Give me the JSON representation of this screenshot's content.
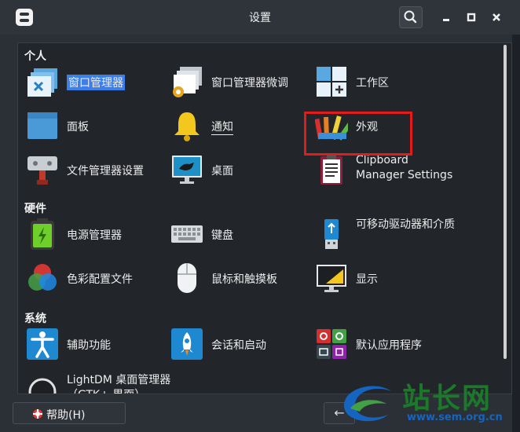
{
  "window": {
    "title": "设置"
  },
  "sections": {
    "personal": "个人",
    "hardware": "硬件",
    "system": "系统"
  },
  "items": {
    "window_manager": "窗口管理器",
    "wm_tweaks": "窗口管理器微调",
    "workspaces": "工作区",
    "panel": "面板",
    "notifications": "通知",
    "appearance": "外观",
    "file_manager": "文件管理器设置",
    "desktop": "桌面",
    "clipboard": "Clipboard Manager Settings",
    "power_manager": "电源管理器",
    "keyboard": "键盘",
    "removable": "可移动驱动器和介质",
    "color_profiles": "色彩配置文件",
    "mouse": "鼠标和触摸板",
    "display": "显示",
    "accessibility": "辅助功能",
    "session": "会话和启动",
    "default_apps": "默认应用程序",
    "lightdm": "LightDM 桌面管理器（GTK+ 界面）"
  },
  "footer": {
    "help_label": "帮助(H)",
    "back_label": "←"
  },
  "watermark": {
    "name": "站长网",
    "url": "www.sem.org.cn"
  },
  "colors": {
    "selection": "#3d7fe8",
    "highlight": "#e21b1b"
  }
}
